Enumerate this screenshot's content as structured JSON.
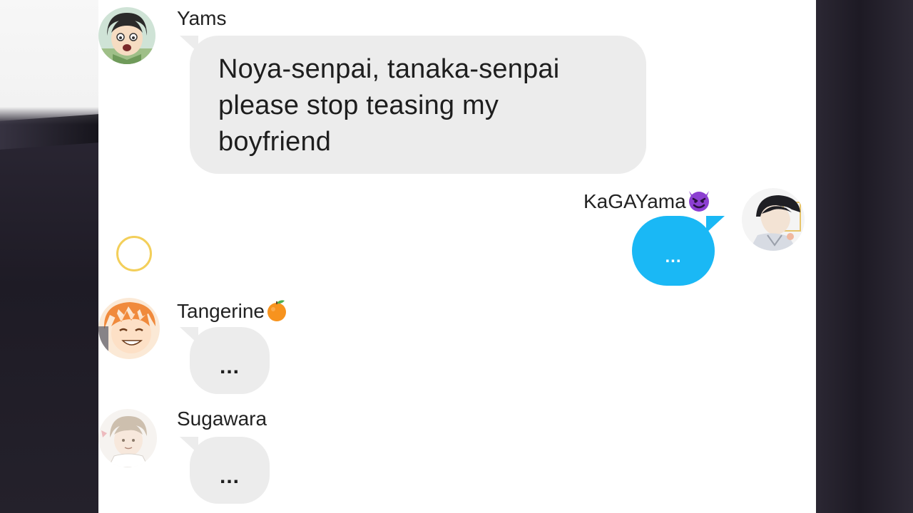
{
  "messages": [
    {
      "sender": "Yams",
      "text": "Noya-senpai, tanaka-senpai please stop teasing my boyfriend",
      "lines": [
        "Noya-senpai, tanaka-senpai",
        "please stop teasing my",
        "boyfriend"
      ],
      "side": "left",
      "avatar_icon": "yamaguchi-avatar"
    },
    {
      "sender": "KaGAYama",
      "sender_emoji": "smiling-devil-emoji",
      "text": "...",
      "side": "right",
      "bubble_color": "#1ab8f5",
      "avatar_icon": "kageyama-avatar"
    },
    {
      "sender": "Tangerine",
      "sender_emoji": "tangerine-emoji",
      "text": "...",
      "side": "left",
      "avatar_icon": "hinata-avatar"
    },
    {
      "sender": "Sugawara",
      "text": "...",
      "side": "left",
      "avatar_icon": "sugawara-avatar"
    }
  ],
  "indicators": {
    "loading_ring_color": "#f3cf5a"
  },
  "colors": {
    "incoming_bubble": "#ececec",
    "outgoing_bubble": "#1ab8f5",
    "chat_background": "#ffffff"
  }
}
